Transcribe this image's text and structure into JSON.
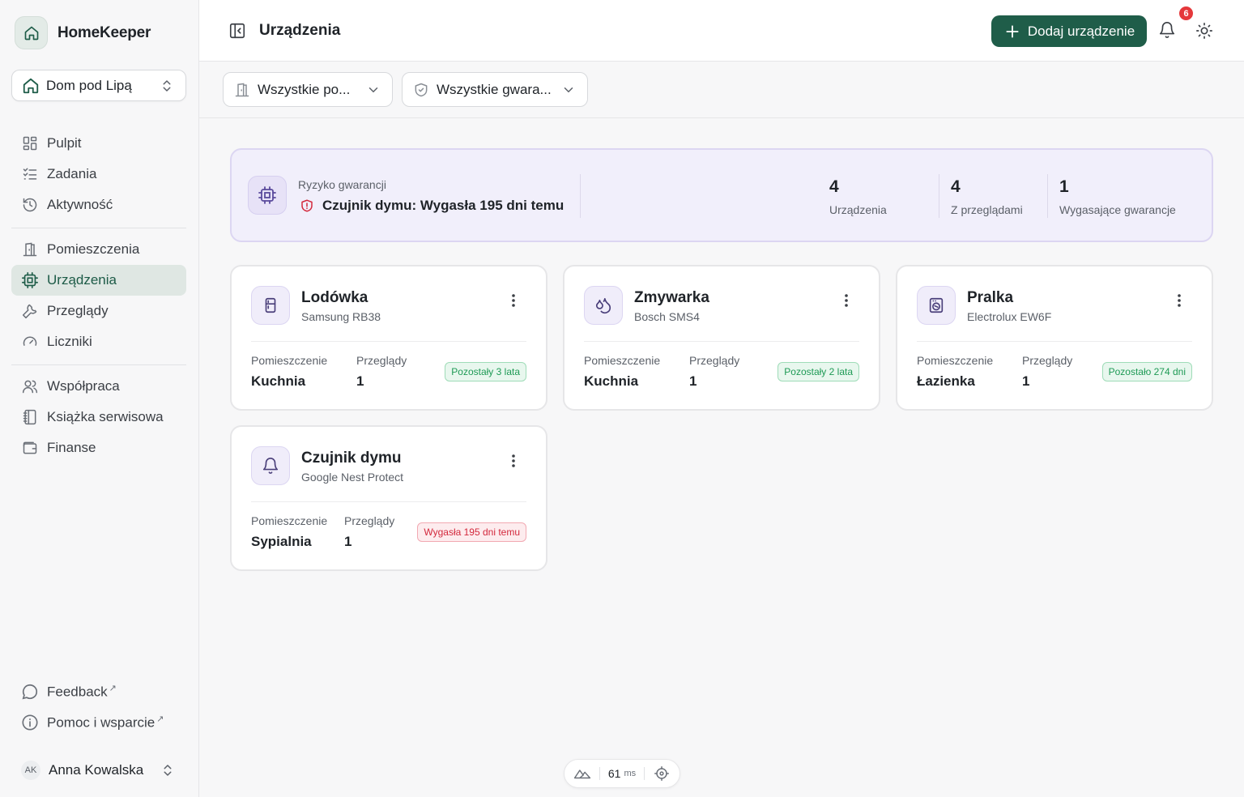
{
  "app": {
    "name": "HomeKeeper"
  },
  "home_switcher": {
    "label": "Dom pod Lipą"
  },
  "nav": {
    "group1": [
      "Pulpit",
      "Zadania",
      "Aktywność"
    ],
    "group2": [
      "Pomieszczenia",
      "Urządzenia",
      "Przeglądy",
      "Liczniki"
    ],
    "group3": [
      "Współpraca",
      "Książka serwisowa",
      "Finanse"
    ],
    "active": "Urządzenia"
  },
  "footer": {
    "feedback": "Feedback",
    "help": "Pomoc i wsparcie",
    "user_initials": "AK",
    "user_name": "Anna Kowalska"
  },
  "header": {
    "title": "Urządzenia",
    "add_button": "Dodaj urządzenie",
    "notifications_count": "6"
  },
  "filters": {
    "rooms": "Wszystkie po...",
    "warranty": "Wszystkie gwara..."
  },
  "summary": {
    "risk_label": "Ryzyko gwarancji",
    "risk_text": "Czujnik dymu: Wygasła 195 dni temu",
    "stats": [
      {
        "value": "4",
        "label": "Urządzenia"
      },
      {
        "value": "4",
        "label": "Z przeglądami"
      },
      {
        "value": "1",
        "label": "Wygasające gwarancje"
      }
    ]
  },
  "card_labels": {
    "room": "Pomieszczenie",
    "inspections": "Przeglądy"
  },
  "devices": [
    {
      "name": "Lodówka",
      "model": "Samsung RB38",
      "room": "Kuchnia",
      "inspections": "1",
      "warranty": "Pozostały 3 lata",
      "status": "ok",
      "icon": "fridge-icon"
    },
    {
      "name": "Zmywarka",
      "model": "Bosch SMS4",
      "room": "Kuchnia",
      "inspections": "1",
      "warranty": "Pozostały 2 lata",
      "status": "ok",
      "icon": "droplets-icon"
    },
    {
      "name": "Pralka",
      "model": "Electrolux EW6F",
      "room": "Łazienka",
      "inspections": "1",
      "warranty": "Pozostało 274 dni",
      "status": "ok",
      "icon": "washing-machine-icon"
    },
    {
      "name": "Czujnik dymu",
      "model": "Google Nest Protect",
      "room": "Sypialnia",
      "inspections": "1",
      "warranty": "Wygasła 195 dni temu",
      "status": "expired",
      "icon": "bell-icon"
    }
  ],
  "perf": {
    "value": "61",
    "unit": "ms"
  },
  "colors": {
    "accent": "#1f5d49",
    "danger": "#e5383b",
    "summary_bg": "#f1effb",
    "ok": "#1e9a55"
  }
}
